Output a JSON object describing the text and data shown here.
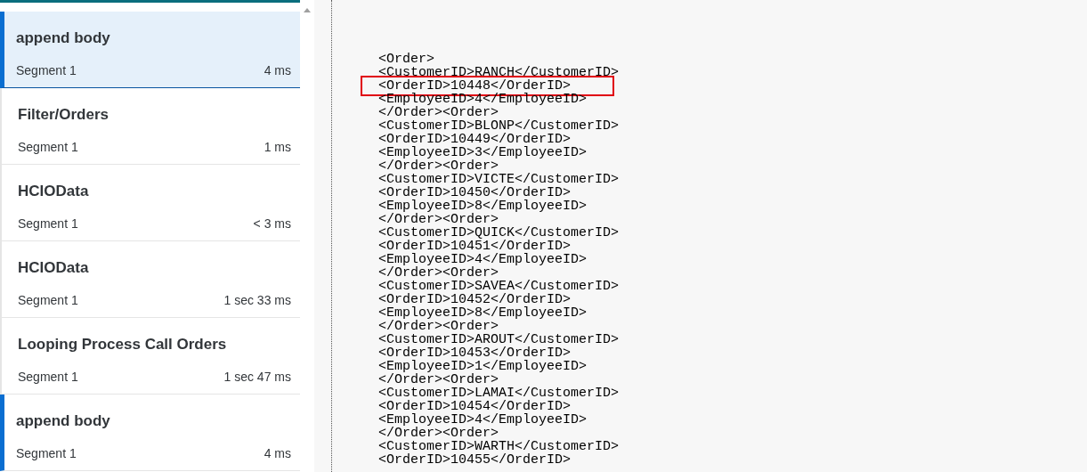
{
  "steps": [
    {
      "title": "append body",
      "segment": "Segment 1",
      "duration": "4 ms",
      "selected": true,
      "marked": true
    },
    {
      "title": "Filter/Orders",
      "segment": "Segment 1",
      "duration": "1 ms",
      "selected": false,
      "marked": false
    },
    {
      "title": "HCIOData",
      "segment": "Segment 1",
      "duration": "< 3 ms",
      "selected": false,
      "marked": false
    },
    {
      "title": "HCIOData",
      "segment": "Segment 1",
      "duration": "1 sec 33 ms",
      "selected": false,
      "marked": false
    },
    {
      "title": "Looping Process Call Orders",
      "segment": "Segment 1",
      "duration": "1 sec 47 ms",
      "selected": false,
      "marked": false
    },
    {
      "title": "append body",
      "segment": "Segment 1",
      "duration": "4 ms",
      "selected": false,
      "marked": true
    }
  ],
  "payload": {
    "lines": [
      {
        "text": "<Order>",
        "highlighted": false
      },
      {
        "text": "<CustomerID>RANCH</CustomerID>",
        "highlighted": false
      },
      {
        "text": "<OrderID>10448</OrderID>",
        "highlighted": true
      },
      {
        "text": "<EmployeeID>4</EmployeeID>",
        "highlighted": false
      },
      {
        "text": "</Order><Order>",
        "highlighted": false
      },
      {
        "text": "<CustomerID>BLONP</CustomerID>",
        "highlighted": false
      },
      {
        "text": "<OrderID>10449</OrderID>",
        "highlighted": false
      },
      {
        "text": "<EmployeeID>3</EmployeeID>",
        "highlighted": false
      },
      {
        "text": "</Order><Order>",
        "highlighted": false
      },
      {
        "text": "<CustomerID>VICTE</CustomerID>",
        "highlighted": false
      },
      {
        "text": "<OrderID>10450</OrderID>",
        "highlighted": false
      },
      {
        "text": "<EmployeeID>8</EmployeeID>",
        "highlighted": false
      },
      {
        "text": "</Order><Order>",
        "highlighted": false
      },
      {
        "text": "<CustomerID>QUICK</CustomerID>",
        "highlighted": false
      },
      {
        "text": "<OrderID>10451</OrderID>",
        "highlighted": false
      },
      {
        "text": "<EmployeeID>4</EmployeeID>",
        "highlighted": false
      },
      {
        "text": "</Order><Order>",
        "highlighted": false
      },
      {
        "text": "<CustomerID>SAVEA</CustomerID>",
        "highlighted": false
      },
      {
        "text": "<OrderID>10452</OrderID>",
        "highlighted": false
      },
      {
        "text": "<EmployeeID>8</EmployeeID>",
        "highlighted": false
      },
      {
        "text": "</Order><Order>",
        "highlighted": false
      },
      {
        "text": "<CustomerID>AROUT</CustomerID>",
        "highlighted": false
      },
      {
        "text": "<OrderID>10453</OrderID>",
        "highlighted": false
      },
      {
        "text": "<EmployeeID>1</EmployeeID>",
        "highlighted": false
      },
      {
        "text": "</Order><Order>",
        "highlighted": false
      },
      {
        "text": "<CustomerID>LAMAI</CustomerID>",
        "highlighted": false
      },
      {
        "text": "<OrderID>10454</OrderID>",
        "highlighted": false
      },
      {
        "text": "<EmployeeID>4</EmployeeID>",
        "highlighted": false
      },
      {
        "text": "</Order><Order>",
        "highlighted": false
      },
      {
        "text": "<CustomerID>WARTH</CustomerID>",
        "highlighted": false
      },
      {
        "text": "<OrderID>10455</OrderID>",
        "highlighted": false
      }
    ]
  }
}
